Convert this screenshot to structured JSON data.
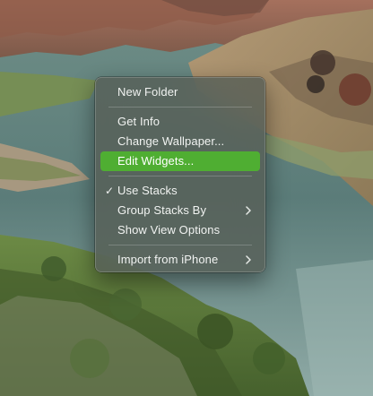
{
  "wallpaper": {
    "description_icon": "landscape-wallpaper",
    "colors": {
      "river": "#5c7d78",
      "cliffs": "#9b6b58",
      "vegetation": "#5f7a3c"
    }
  },
  "context_menu": {
    "highlight_color": "#4fae32",
    "groups": [
      [
        {
          "label": "New Folder",
          "checked": false,
          "submenu": false,
          "highlighted": false
        }
      ],
      [
        {
          "label": "Get Info",
          "checked": false,
          "submenu": false,
          "highlighted": false
        },
        {
          "label": "Change Wallpaper...",
          "checked": false,
          "submenu": false,
          "highlighted": false
        },
        {
          "label": "Edit Widgets...",
          "checked": false,
          "submenu": false,
          "highlighted": true
        }
      ],
      [
        {
          "label": "Use Stacks",
          "checked": true,
          "submenu": false,
          "highlighted": false
        },
        {
          "label": "Group Stacks By",
          "checked": false,
          "submenu": true,
          "highlighted": false
        },
        {
          "label": "Show View Options",
          "checked": false,
          "submenu": false,
          "highlighted": false
        }
      ],
      [
        {
          "label": "Import from iPhone",
          "checked": false,
          "submenu": true,
          "highlighted": false
        }
      ]
    ]
  }
}
